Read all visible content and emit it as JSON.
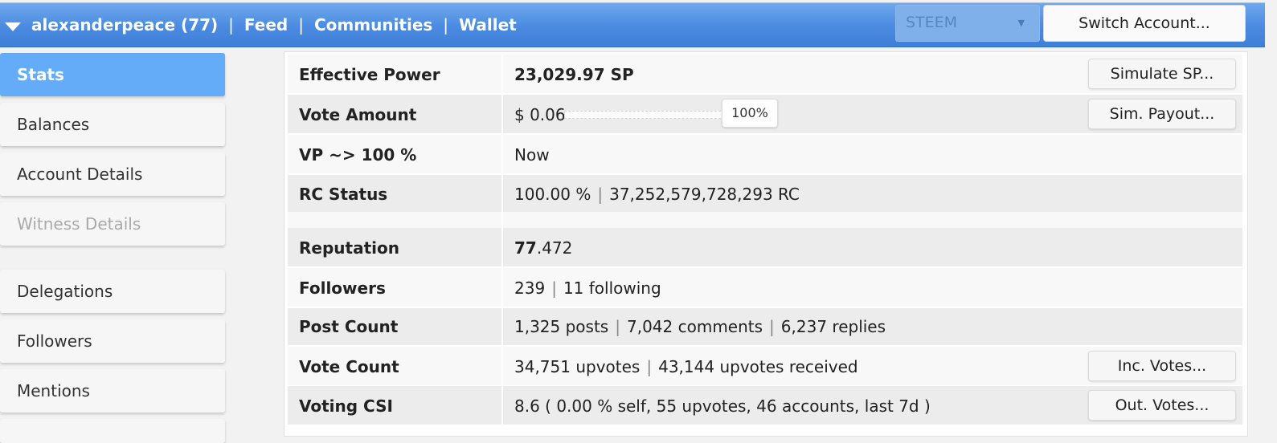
{
  "header": {
    "account": "alexanderpeace (77)",
    "sep": "|",
    "nav": [
      "Feed",
      "Communities",
      "Wallet"
    ],
    "coin": "STEEM",
    "switch_label": "Switch Account..."
  },
  "sidebar": {
    "items": [
      {
        "label": "Stats",
        "state": "active"
      },
      {
        "label": "Balances"
      },
      {
        "label": "Account Details"
      },
      {
        "label": "Witness Details",
        "state": "disabled"
      },
      {
        "label": "Delegations"
      },
      {
        "label": "Followers"
      },
      {
        "label": "Mentions"
      }
    ]
  },
  "stats": {
    "effective_power": {
      "label": "Effective Power",
      "value": "23,029.97 SP",
      "button": "Simulate SP..."
    },
    "vote_amount": {
      "label": "Vote Amount",
      "value": "$ 0.06",
      "percent": "100%",
      "slider_level": 1.0,
      "button": "Sim. Payout..."
    },
    "vp": {
      "label": "VP ~> 100 %",
      "value": "Now"
    },
    "rc": {
      "label": "RC Status",
      "percent": "100.00 %",
      "amount": "37,252,579,728,293 RC"
    },
    "reputation": {
      "label": "Reputation",
      "int_part": "77",
      "dec_part": ".472"
    },
    "followers": {
      "label": "Followers",
      "count": "239",
      "following": "11 following"
    },
    "posts": {
      "label": "Post Count",
      "posts": "1,325 posts",
      "comments": "7,042 comments",
      "replies": "6,237 replies"
    },
    "votes": {
      "label": "Vote Count",
      "upvotes": "34,751 upvotes",
      "received": "43,144 upvotes received",
      "button": "Inc. Votes..."
    },
    "csi": {
      "label": "Voting CSI",
      "value": "8.6 ( 0.00 % self, 55 upvotes, 46 accounts, last 7d )",
      "button": "Out. Votes..."
    }
  },
  "colors": {
    "header_blue": "#4a8ae0",
    "active_tab": "#64acf8"
  }
}
